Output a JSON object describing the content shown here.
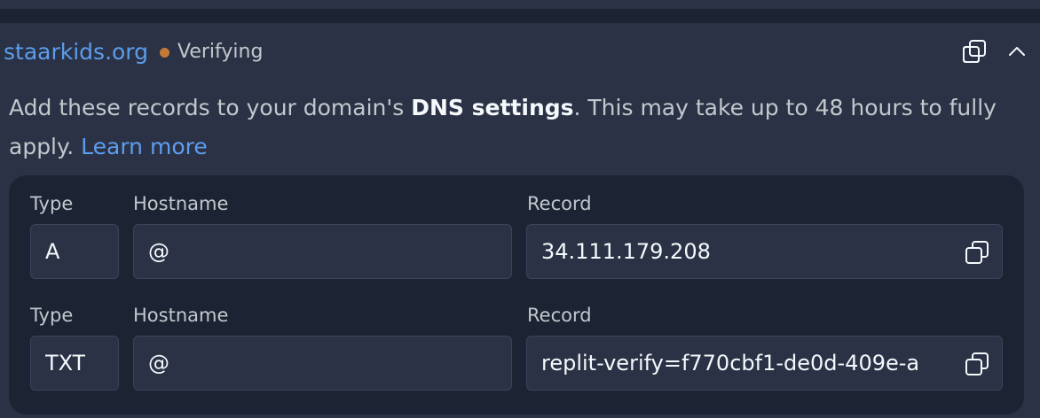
{
  "domain": {
    "name": "staarkids.org",
    "status": "Verifying",
    "status_color": "#c77a36",
    "link_color": "#5c9ded"
  },
  "icons": {
    "copy": "copy-icon",
    "collapse": "chevron-up-icon"
  },
  "description": {
    "before": "Add these records to your domain's ",
    "bold": "DNS settings",
    "after": ". This may take up to 48 hours to fully apply. ",
    "link": "Learn more"
  },
  "labels": {
    "type": "Type",
    "hostname": "Hostname",
    "record": "Record"
  },
  "records": [
    {
      "type": "A",
      "hostname": "@",
      "record": "34.111.179.208"
    },
    {
      "type": "TXT",
      "hostname": "@",
      "record": "replit-verify=f770cbf1-de0d-409e-a"
    }
  ]
}
